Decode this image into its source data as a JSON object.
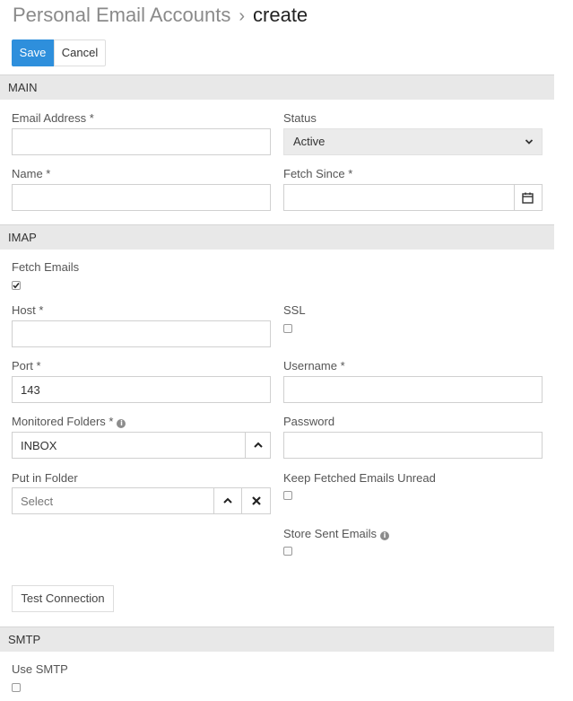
{
  "header": {
    "breadcrumb_parent": "Personal Email Accounts",
    "separator": "›",
    "title": "create"
  },
  "actions": {
    "save_label": "Save",
    "cancel_label": "Cancel"
  },
  "sections": {
    "main": "MAIN",
    "imap": "IMAP",
    "smtp": "SMTP"
  },
  "main": {
    "email_label": "Email Address *",
    "email_value": "",
    "status_label": "Status",
    "status_value": "Active",
    "name_label": "Name *",
    "name_value": "",
    "fetch_since_label": "Fetch Since *",
    "fetch_since_value": ""
  },
  "imap": {
    "fetch_emails_label": "Fetch Emails",
    "fetch_emails_checked": true,
    "host_label": "Host *",
    "host_value": "",
    "ssl_label": "SSL",
    "ssl_checked": false,
    "port_label": "Port *",
    "port_value": "143",
    "username_label": "Username *",
    "username_value": "",
    "monitored_folders_label": "Monitored Folders *",
    "monitored_folders_value": "INBOX",
    "password_label": "Password",
    "password_value": "",
    "put_in_folder_label": "Put in Folder",
    "put_in_folder_placeholder": "Select",
    "keep_unread_label": "Keep Fetched Emails Unread",
    "keep_unread_checked": false,
    "store_sent_label": "Store Sent Emails",
    "store_sent_checked": false,
    "test_connection_label": "Test Connection"
  },
  "smtp": {
    "use_smtp_label": "Use SMTP",
    "use_smtp_checked": false
  },
  "colors": {
    "primary": "#2e8fdc",
    "section_bg": "#e8e8e8",
    "select_bg": "#ebebeb"
  },
  "icons": {
    "status_chevron": "chevron-down-icon",
    "fetch_since_addon": "calendar-icon",
    "monitored_folders_addon": "chevron-up-icon",
    "put_in_folder_addons": [
      "chevron-up-icon",
      "close-icon"
    ],
    "info": "info-icon",
    "checkbox_checked": "checkmark-icon"
  }
}
